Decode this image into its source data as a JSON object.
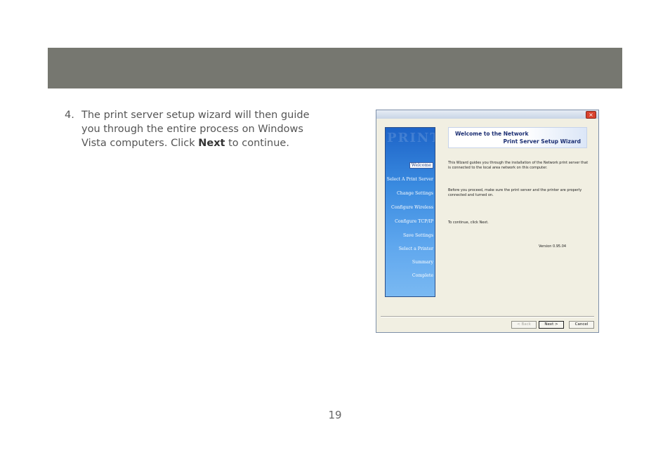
{
  "step": {
    "number": "4.",
    "text_before": "The print server setup wizard will then guide you through the entire process on Windows Vista computers.  Click ",
    "bold_word": "Next",
    "text_after": " to continue."
  },
  "page_number": "19",
  "wizard": {
    "close_symbol": "×",
    "watermark": "PRINT",
    "banner_line1": "Welcome to the Network",
    "banner_line2": "Print Server Setup Wizard",
    "steps": [
      "Welcome",
      "Select A Print Server",
      "Change Settings",
      "Configure Wireless",
      "Configure TCP/IP",
      "Save Settings",
      "Select a Printer",
      "Summary",
      "Complete"
    ],
    "paragraph1": "This Wizard guides you through the installation of the Network print server that is connected to the local area network on this computer.",
    "paragraph2": "Before you proceed, make sure the print server and the printer are properly connected and turned on.",
    "paragraph3": "To continue, click Next.",
    "version": "Version 0.95.04",
    "buttons": {
      "back": "< Back",
      "next": "Next >",
      "cancel": "Cancel"
    }
  },
  "colors": {
    "header_band": "#767770",
    "side_panel": "#3a8be0"
  }
}
